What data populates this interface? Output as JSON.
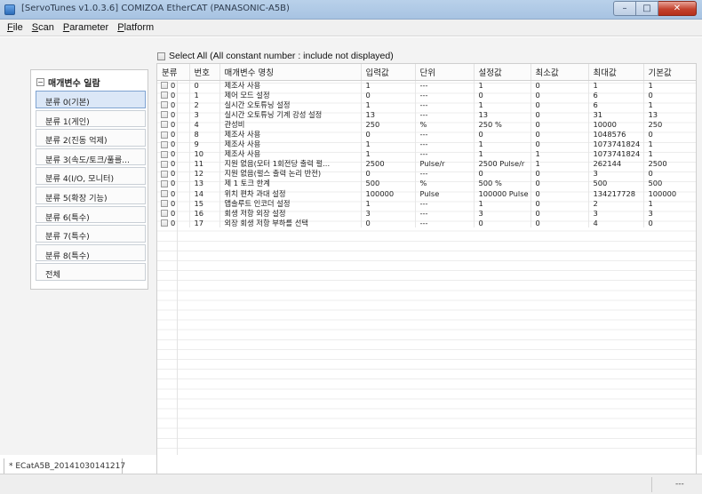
{
  "window": {
    "title": "[ServoTunes v1.0.3.6] COMIZOA EtherCAT (PANASONIC-A5B)"
  },
  "menu": {
    "items": [
      {
        "accel": "F",
        "rest": "ile"
      },
      {
        "accel": "S",
        "rest": "can"
      },
      {
        "accel": "P",
        "rest": "arameter"
      },
      {
        "accel": "P",
        "rest": "latform"
      }
    ]
  },
  "sidebar": {
    "toggle": "−",
    "title": "매개변수 일람",
    "items": [
      "분류 0(기본)",
      "분류 1(게인)",
      "분류 2(진동 억제)",
      "분류 3(속도/토크/풀를...",
      "분류 4(I/O, 모니터)",
      "분류 5(확장 기능)",
      "분류 6(특수)",
      "분류 7(특수)",
      "분류 8(특수)",
      "전체"
    ],
    "selected_index": 0
  },
  "select_all": {
    "label": "Select All (All constant number : include not displayed)"
  },
  "table": {
    "headers": [
      "분류",
      "번호",
      "매개변수 명칭",
      "입력값",
      "단위",
      "설정값",
      "최소값",
      "최대값",
      "기본값"
    ],
    "rows": [
      [
        "0",
        "0",
        "제조사 사용",
        "1",
        "---",
        "1",
        "0",
        "1",
        "1"
      ],
      [
        "0",
        "1",
        "제어 모드 설정",
        "0",
        "---",
        "0",
        "0",
        "6",
        "0"
      ],
      [
        "0",
        "2",
        "실시간 오토튜닝 설정",
        "1",
        "---",
        "1",
        "0",
        "6",
        "1"
      ],
      [
        "0",
        "3",
        "실시간 오토튜닝 기계 강성 설정",
        "13",
        "---",
        "13",
        "0",
        "31",
        "13"
      ],
      [
        "0",
        "4",
        "관성비",
        "250",
        "%",
        "250 %",
        "0",
        "10000",
        "250"
      ],
      [
        "0",
        "8",
        "제조사 사용",
        "0",
        "---",
        "0",
        "0",
        "1048576",
        "0"
      ],
      [
        "0",
        "9",
        "제조사 사용",
        "1",
        "---",
        "1",
        "0",
        "1073741824",
        "1"
      ],
      [
        "0",
        "10",
        "제조사 사용",
        "1",
        "---",
        "1",
        "1",
        "1073741824",
        "1"
      ],
      [
        "0",
        "11",
        "지원 없음(모터 1회전당 출력 펄...",
        "2500",
        "Pulse/r",
        "2500 Pulse/r",
        "1",
        "262144",
        "2500"
      ],
      [
        "0",
        "12",
        "지원 없음(펄스 출력 논리 반전)",
        "0",
        "---",
        "0",
        "0",
        "3",
        "0"
      ],
      [
        "0",
        "13",
        "제 1 토크 한계",
        "500",
        "%",
        "500 %",
        "0",
        "500",
        "500"
      ],
      [
        "0",
        "14",
        "위치 편차 과대 설정",
        "100000",
        "Pulse",
        "100000 Pulse",
        "0",
        "134217728",
        "100000"
      ],
      [
        "0",
        "15",
        "앱솔루트 인코더 설정",
        "1",
        "---",
        "1",
        "0",
        "2",
        "1"
      ],
      [
        "0",
        "16",
        "회생 저항 외장 설정",
        "3",
        "---",
        "3",
        "0",
        "3",
        "3"
      ],
      [
        "0",
        "17",
        "외장 회생 저항 부하를 선택",
        "0",
        "---",
        "0",
        "0",
        "4",
        "0"
      ]
    ]
  },
  "document_tab": {
    "label": "* ECatA5B_20141030141217"
  },
  "status": {
    "right_text": "---"
  }
}
